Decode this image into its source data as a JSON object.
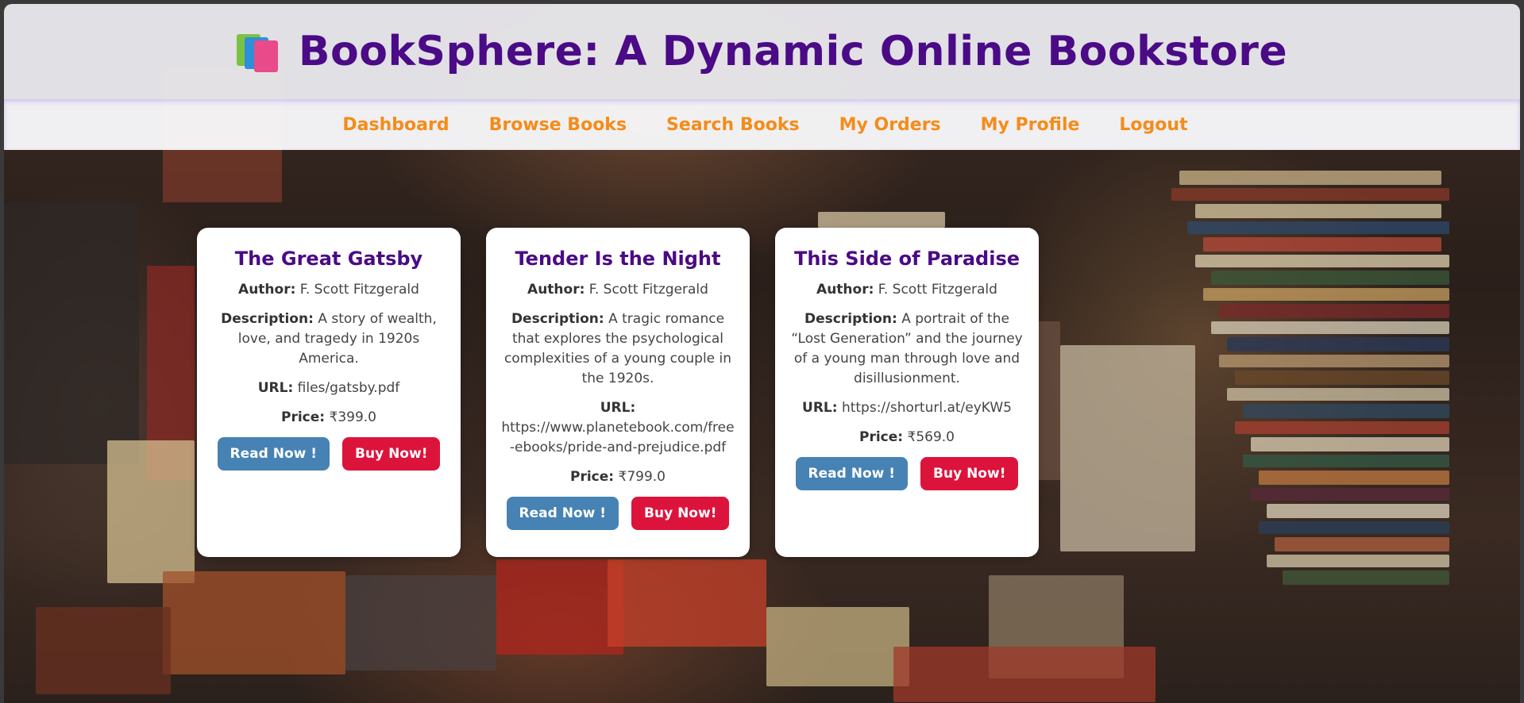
{
  "header": {
    "title": "BookSphere: A Dynamic Online Bookstore",
    "logo_icon": "books-stack-icon"
  },
  "nav": {
    "items": [
      "Dashboard",
      "Browse Books",
      "Search Books",
      "My Orders",
      "My Profile",
      "Logout"
    ]
  },
  "labels": {
    "author": "Author:",
    "description": "Description:",
    "url": "URL:",
    "price": "Price:",
    "read_button": "Read Now !",
    "buy_button": "Buy Now!"
  },
  "books": [
    {
      "title": "The Great Gatsby",
      "author": "F. Scott Fitzgerald",
      "description": "A story of wealth, love, and tragedy in 1920s America.",
      "url": "files/gatsby.pdf",
      "price": "₹399.0"
    },
    {
      "title": "Tender Is the Night",
      "author": "F. Scott Fitzgerald",
      "description": "A tragic romance that explores the psychological complexities of a young couple in the 1920s.",
      "url": "https://www.planetebook.com/free-ebooks/pride-and-prejudice.pdf",
      "price": "₹799.0"
    },
    {
      "title": "This Side of Paradise",
      "author": "F. Scott Fitzgerald",
      "description": "A portrait of the “Lost Generation” and the journey of a young man through love and disillusionment.",
      "url": "https://shorturl.at/eyKW5",
      "price": "₹569.0"
    }
  ],
  "colors": {
    "title": "#4b0a86",
    "nav_link": "#f48c1a",
    "read_button": "#4682b4",
    "buy_button": "#dc143c"
  }
}
